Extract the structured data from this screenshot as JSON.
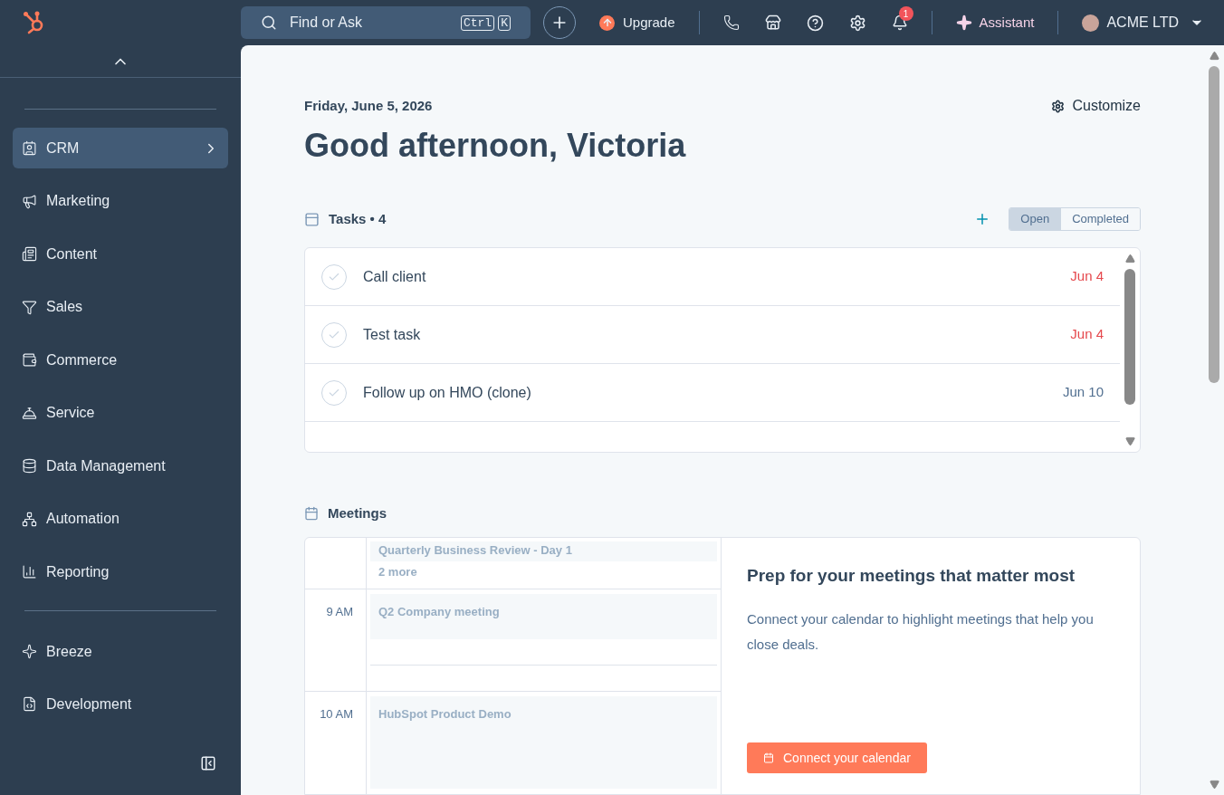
{
  "topbar": {
    "search": {
      "placeholder": "Find or Ask",
      "keys": [
        "Ctrl",
        "K"
      ]
    },
    "upgrade": "Upgrade",
    "notifications": "1",
    "assistant": "Assistant",
    "account": "ACME LTD"
  },
  "sidebar": {
    "items": [
      {
        "label": "CRM",
        "selected": true
      },
      {
        "label": "Marketing",
        "selected": false
      },
      {
        "label": "Content",
        "selected": false
      },
      {
        "label": "Sales",
        "selected": false
      },
      {
        "label": "Commerce",
        "selected": false
      },
      {
        "label": "Service",
        "selected": false
      },
      {
        "label": "Data Management",
        "selected": false
      },
      {
        "label": "Automation",
        "selected": false
      },
      {
        "label": "Reporting",
        "selected": false
      }
    ],
    "bottom_items": [
      {
        "label": "Breeze",
        "selected": false
      },
      {
        "label": "Development",
        "selected": false
      }
    ]
  },
  "date": "Friday, June 5, 2026",
  "greeting": "Good afternoon, Victoria",
  "customize": "Customize",
  "tasks": {
    "title": "Tasks • 4",
    "tabs": [
      {
        "label": "Open",
        "selected": true
      },
      {
        "label": "Completed",
        "selected": false
      }
    ],
    "rows": [
      {
        "title": "Call client",
        "due": "Jun 4",
        "overdue": true,
        "completed": false
      },
      {
        "title": "Test task",
        "due": "Jun 4",
        "overdue": true,
        "completed": false
      },
      {
        "title": "Follow up on HMO (clone)",
        "due": "Jun 10",
        "overdue": false,
        "completed": false
      }
    ]
  },
  "meetings": {
    "title": "Meetings",
    "all_day": [
      {
        "title": "Quarterly Business Review - Day 1"
      }
    ],
    "more": "2 more",
    "slots": [
      {
        "time": "9 AM",
        "event": "Q2 Company meeting"
      },
      {
        "time": "10 AM",
        "event": "HubSpot Product Demo"
      }
    ],
    "prep_title": "Prep for your meetings that matter most",
    "prep_text": "Connect your calendar to highlight meetings that help you close deals.",
    "connect": "Connect your calendar"
  }
}
